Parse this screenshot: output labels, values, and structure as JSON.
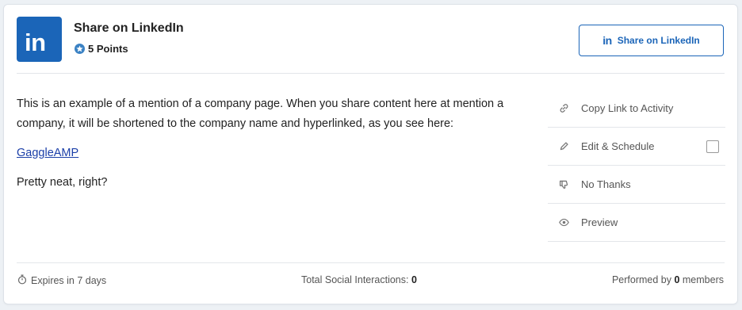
{
  "header": {
    "logo_text": "in",
    "title": "Share on LinkedIn",
    "points": "5 Points",
    "share_button_glyph": "in",
    "share_button_label": "Share on LinkedIn"
  },
  "content": {
    "paragraph_1": "This is an example of a mention of a company page. When you share content here at mention a company, it will be shortened to the company name and hyperlinked, as you see here:",
    "link_text": "GaggleAMP",
    "paragraph_2": "Pretty neat, right?"
  },
  "actions": [
    {
      "label": "Copy Link to Activity",
      "icon": "link-icon"
    },
    {
      "label": "Edit & Schedule",
      "icon": "pencil-icon"
    },
    {
      "label": "No Thanks",
      "icon": "thumbs-down-icon"
    },
    {
      "label": "Preview",
      "icon": "eye-icon"
    }
  ],
  "footer": {
    "expires": "Expires in 7 days",
    "interactions_label": "Total Social Interactions: ",
    "interactions_value": "0",
    "performed_prefix": "Performed by ",
    "performed_value": "0",
    "performed_suffix": " members"
  },
  "colors": {
    "brand": "#1b65b8",
    "link": "#1b3fa8",
    "border": "#e3e6ea"
  }
}
